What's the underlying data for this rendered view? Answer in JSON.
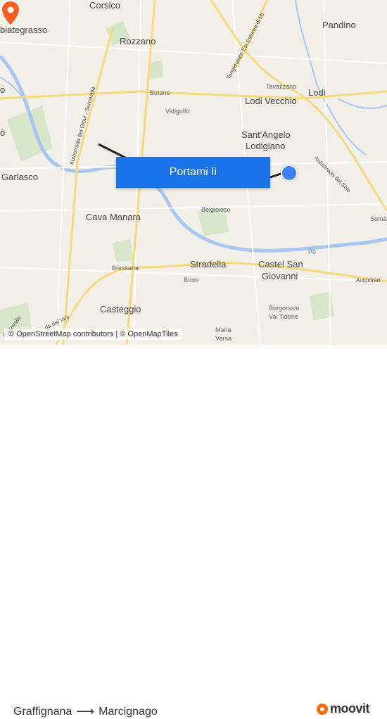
{
  "map": {
    "places": [
      {
        "id": "corsico",
        "label": "Corsico",
        "cls": "big"
      },
      {
        "id": "abbiategrasso",
        "label": "biategrasso",
        "cls": "big"
      },
      {
        "id": "pandino",
        "label": "Pandino",
        "cls": "big"
      },
      {
        "id": "rozzano",
        "label": "Rozzano",
        "cls": "big"
      },
      {
        "id": "siziano",
        "label": "Siziano",
        "cls": "small"
      },
      {
        "id": "vidigulfo",
        "label": "Vidigulfo",
        "cls": "small"
      },
      {
        "id": "tavazzano",
        "label": "Tavazzano",
        "cls": "small"
      },
      {
        "id": "lodi",
        "label": "Lodi",
        "cls": "big"
      },
      {
        "id": "lodivecchio",
        "label": "Lodi Vecchio",
        "cls": "big"
      },
      {
        "id": "santangelo1",
        "label": "Sant'Angelo",
        "cls": "big"
      },
      {
        "id": "santangelo2",
        "label": "Lodigiano",
        "cls": "big"
      },
      {
        "id": "garlasco",
        "label": "Garlasco",
        "cls": "big"
      },
      {
        "id": "cavamanara",
        "label": "Cava Manara",
        "cls": "big"
      },
      {
        "id": "belgioioso",
        "label": "Belgioioso",
        "cls": "small"
      },
      {
        "id": "somaglia",
        "label": "Soma",
        "cls": "small"
      },
      {
        "id": "stradella",
        "label": "Stradella",
        "cls": "big"
      },
      {
        "id": "castelsangiovanni1",
        "label": "Castel San",
        "cls": "big"
      },
      {
        "id": "castelsangiovanni2",
        "label": "Giovanni",
        "cls": "big"
      },
      {
        "id": "bressana",
        "label": "Bressana",
        "cls": "small"
      },
      {
        "id": "broni",
        "label": "Broni",
        "cls": "small"
      },
      {
        "id": "casteggio",
        "label": "Casteggio",
        "cls": "big"
      },
      {
        "id": "borgonovo1",
        "label": "Borgonovo",
        "cls": "small"
      },
      {
        "id": "borgonovo2",
        "label": "Val Tidone",
        "cls": "small"
      },
      {
        "id": "santamaria1",
        "label": "Maria",
        "cls": "small"
      },
      {
        "id": "santamaria2",
        "label": "Versa",
        "cls": "small"
      },
      {
        "id": "left_o",
        "label": "o",
        "cls": "big"
      },
      {
        "id": "left_o2",
        "label": "ò",
        "cls": "big"
      }
    ],
    "roads": [
      {
        "id": "tangenziale",
        "label": "Tangenziale Est Esterna di Mi"
      },
      {
        "id": "giovi",
        "label": "Autostrada dei Giovi - Serravalle"
      },
      {
        "id": "sole",
        "label": "Autostrada del Sole"
      },
      {
        "id": "autostrada_right",
        "label": "Autostrad"
      },
      {
        "id": "serravalle_left",
        "label": "Serravalle"
      },
      {
        "id": "vini",
        "label": "da dei Vini"
      }
    ],
    "water": [
      {
        "id": "po",
        "label": "Po"
      }
    ],
    "colors": {
      "land": "#f2efe9",
      "water": "#a9c6f0",
      "road_major": "#f6d97a",
      "road_minor": "#ffffff",
      "green": "#cfe3bf",
      "route": "#222222",
      "origin_pin": "#ff5a1f",
      "destination": "#3b82f6",
      "cta": "#1a73e8"
    }
  },
  "cta": {
    "label": "Portami lì"
  },
  "attribution": {
    "text": "© OpenStreetMap contributors | © OpenMapTiles"
  },
  "route": {
    "from": "Graffignana",
    "to": "Marcignago",
    "arrow": "⟶"
  },
  "brand": {
    "name": "moovit",
    "icon": "moovit-logo-icon"
  }
}
